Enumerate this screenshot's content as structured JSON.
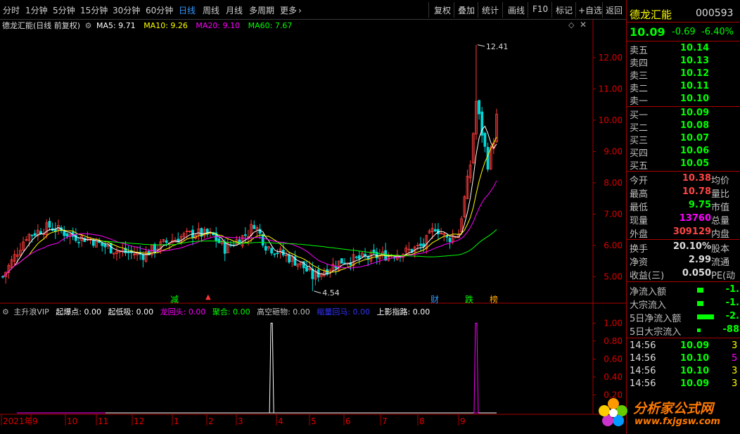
{
  "toolbar": {
    "periods": [
      "分时",
      "1分钟",
      "5分钟",
      "15分钟",
      "30分钟",
      "60分钟",
      "日线",
      "周线",
      "月线",
      "多周期",
      "更多"
    ],
    "active_period": "日线",
    "more_arrow": "›",
    "right_buttons": [
      "复权",
      "叠加",
      "统计",
      "画线",
      "F10",
      "标记",
      "+自选",
      "返回"
    ]
  },
  "legend": {
    "name": "德龙汇能(日线 前复权)",
    "ma5": "MA5: 9.71",
    "ma10": "MA10: 9.26",
    "ma20": "MA20: 9.10",
    "ma60": "MA60: 7.67",
    "colors": {
      "ma5": "#ffffff",
      "ma10": "#ffff00",
      "ma20": "#ff00ff",
      "ma60": "#00ff00"
    }
  },
  "indicator_legend": [
    {
      "text": "主升浪VIP",
      "color": "#c0c0c0"
    },
    {
      "text": "起爆点: 0.00",
      "color": "#ffffff"
    },
    {
      "text": "起低吸: 0.00",
      "color": "#ffffff"
    },
    {
      "text": "龙回头: 0.00",
      "color": "#ff00ff"
    },
    {
      "text": "聚合: 0.00",
      "color": "#00ff00"
    },
    {
      "text": "高空砸物: 0.00",
      "color": "#c0c0c0"
    },
    {
      "text": "缩量回马: 0.00",
      "color": "#0000ff"
    },
    {
      "text": "上影指路: 0.00",
      "color": "#ffffff"
    }
  ],
  "markers": [
    {
      "text": "减",
      "color": "#00ff00"
    },
    {
      "text": "财",
      "color": "#3399ff"
    },
    {
      "text": "跌",
      "color": "#00ff00"
    },
    {
      "text": "榜",
      "color": "#ffaa00"
    }
  ],
  "price_annotations": {
    "high": "12.41",
    "low": "4.54"
  },
  "chart_data": {
    "type": "candlestick",
    "title": "德龙汇能(日线 前复权)",
    "y_ticks": [
      "12.00",
      "11.00",
      "10.00",
      "9.00",
      "8.00",
      "7.00",
      "6.00",
      "5.00"
    ],
    "ylim": [
      4.4,
      12.9
    ],
    "x_ticks": [
      "2021年",
      "9",
      "10",
      "11",
      "12",
      "1",
      "2",
      "3",
      "4",
      "5",
      "6",
      "7",
      "8",
      "9"
    ],
    "ma": {
      "MA5": 9.71,
      "MA10": 9.26,
      "MA20": 9.1,
      "MA60": 7.67
    },
    "key_points": {
      "high": 12.41,
      "low": 4.54,
      "last": 10.09
    },
    "indicator": {
      "name": "主升浪VIP",
      "y_ticks": [
        "1.00",
        "0.80",
        "0.60",
        "0.40",
        "0.20"
      ],
      "ylim": [
        0,
        1.05
      ],
      "spikes": [
        {
          "near_x_tick": "3",
          "value": 1.0,
          "color": "#ffffff"
        },
        {
          "near_x_tick": "9",
          "value": 1.0,
          "color": "#ff00ff"
        }
      ]
    }
  },
  "quote": {
    "name": "德龙汇能",
    "code": "000593",
    "price": "10.09",
    "change": "-0.69",
    "change_pct": "-6.40%",
    "asks": [
      {
        "label": "卖五",
        "price": "10.14"
      },
      {
        "label": "卖四",
        "price": "10.13"
      },
      {
        "label": "卖三",
        "price": "10.12"
      },
      {
        "label": "卖二",
        "price": "10.11"
      },
      {
        "label": "卖一",
        "price": "10.10"
      }
    ],
    "bids": [
      {
        "label": "买一",
        "price": "10.09"
      },
      {
        "label": "买二",
        "price": "10.08"
      },
      {
        "label": "买三",
        "price": "10.07"
      },
      {
        "label": "买四",
        "price": "10.06"
      },
      {
        "label": "买五",
        "price": "10.05"
      }
    ],
    "stats": [
      {
        "label": "今开",
        "value": "10.38",
        "value_color": "#ff4444",
        "right": "均价"
      },
      {
        "label": "最高",
        "value": "10.78",
        "value_color": "#ff4444",
        "right": "量比"
      },
      {
        "label": "最低",
        "value": "9.75",
        "value_color": "#00ff00",
        "right": "市值"
      },
      {
        "label": "现量",
        "value": "13760",
        "value_color": "#ff00ff",
        "right": "总量"
      },
      {
        "label": "外盘",
        "value": "309129",
        "value_color": "#ff4444",
        "right": "内盘"
      }
    ],
    "extra": [
      {
        "label": "换手",
        "value": "20.10%",
        "right": "股本"
      },
      {
        "label": "净资",
        "value": "2.99",
        "right": "流通"
      },
      {
        "label": "收益(三)",
        "value": "0.050",
        "right": "PE(动"
      }
    ],
    "flows": [
      {
        "label": "净流入额",
        "value": "-1."
      },
      {
        "label": "大宗流入",
        "value": "-1."
      },
      {
        "label": "5日净流入额",
        "value": "-2."
      },
      {
        "label": "5日大宗流入",
        "value": "-88"
      }
    ],
    "ticks": [
      {
        "time": "14:56",
        "price": "10.09",
        "vol": "3"
      },
      {
        "time": "14:56",
        "price": "10.10",
        "vol": "5"
      },
      {
        "time": "14:56",
        "price": "10.10",
        "vol": "3"
      },
      {
        "time": "14:56",
        "price": "10.09",
        "vol": "3"
      }
    ]
  },
  "watermark": {
    "title": "分析家公式网",
    "url": "www.fxjgsw.com"
  }
}
